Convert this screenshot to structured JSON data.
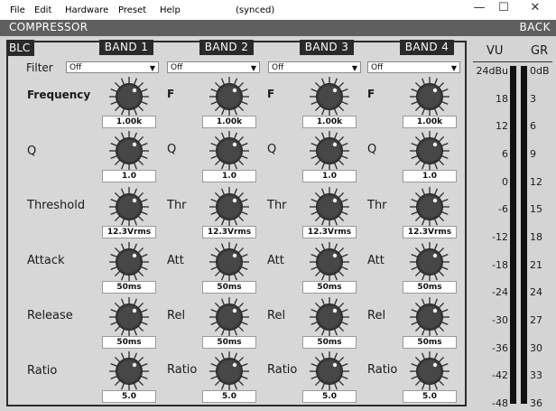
{
  "menu": {
    "items": [
      "File",
      "Edit",
      "Hardware",
      "Preset",
      "Help"
    ],
    "title": "(synced)"
  },
  "window": {
    "minimize": "—",
    "maximize": "☐",
    "close": "✕"
  },
  "header": {
    "title": "COMPRESSOR",
    "back": "BACK"
  },
  "blc": "BLC",
  "bands": [
    {
      "name": "BAND 1",
      "filter": "Off",
      "labels": [
        "F",
        "Q",
        "Thr",
        "Att",
        "Rel",
        "Ratio"
      ],
      "values": [
        "1.00k",
        "1.0",
        "12.3Vrms",
        "50ms",
        "50ms",
        "5.0"
      ]
    },
    {
      "name": "BAND 2",
      "filter": "Off",
      "labels": [
        "F",
        "Q",
        "Thr",
        "Att",
        "Rel",
        "Ratio"
      ],
      "values": [
        "1.00k",
        "1.0",
        "12.3Vrms",
        "50ms",
        "50ms",
        "5.0"
      ]
    },
    {
      "name": "BAND 3",
      "filter": "Off",
      "labels": [
        "F",
        "Q",
        "Thr",
        "Att",
        "Rel",
        "Ratio"
      ],
      "values": [
        "1.00k",
        "1.0",
        "12.3Vrms",
        "50ms",
        "50ms",
        "5.0"
      ]
    },
    {
      "name": "BAND 4",
      "filter": "Off",
      "labels": [
        "F",
        "Q",
        "Thr",
        "Att",
        "Rel",
        "Ratio"
      ],
      "values": [
        "1.00k",
        "1.0",
        "12.3Vrms",
        "50ms",
        "50ms",
        "5.0"
      ]
    }
  ],
  "rows": {
    "filter": "Filter",
    "frequency": "Frequency",
    "q": "Q",
    "threshold": "Threshold",
    "attack": "Attack",
    "release": "Release",
    "ratio": "Ratio"
  },
  "meters": {
    "vu_label": "VU",
    "gr_label": "GR",
    "vu_ticks": [
      "24dBu",
      "18",
      "12",
      "6",
      "0",
      "-6",
      "-12",
      "-18",
      "-24",
      "-30",
      "-36",
      "-42",
      "-48"
    ],
    "gr_ticks": [
      "0dB",
      "3",
      "6",
      "9",
      "12",
      "15",
      "18",
      "21",
      "24",
      "27",
      "30",
      "33",
      "36"
    ]
  },
  "colors": {
    "panel": "#d7d7d7",
    "header": "#5f5f5f",
    "band_header": "#2a2a2a",
    "knob": "#3a3a3a"
  }
}
